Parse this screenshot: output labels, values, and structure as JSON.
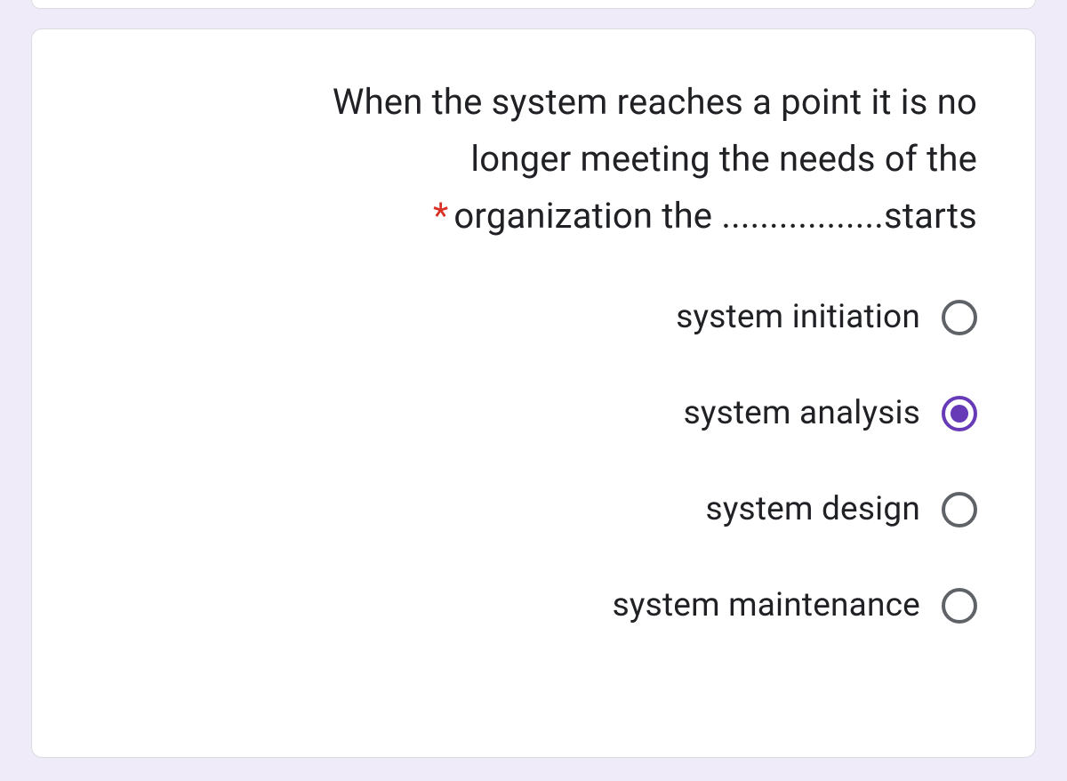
{
  "question": {
    "text_line1": "When the system reaches a point it is no",
    "text_line2": "longer meeting the needs of the",
    "text_line3": "organization the .................starts",
    "required": "*"
  },
  "options": [
    {
      "label": "system initiation",
      "selected": false
    },
    {
      "label": "system analysis",
      "selected": true
    },
    {
      "label": "system design",
      "selected": false
    },
    {
      "label": "system maintenance",
      "selected": false
    }
  ]
}
